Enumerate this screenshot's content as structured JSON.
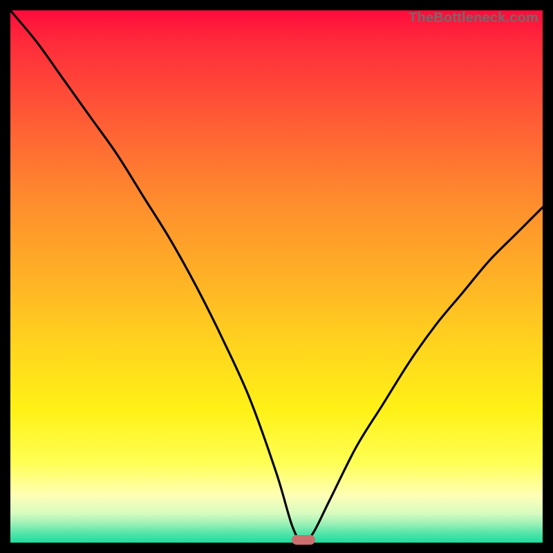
{
  "watermark": "TheBottleneck.com",
  "colors": {
    "frame": "#000000",
    "curve": "#000000",
    "marker": "#cc6f6f",
    "gradient_top": "#ff0b3b",
    "gradient_bottom": "#1ddc9f"
  },
  "chart_data": {
    "type": "line",
    "title": "",
    "xlabel": "",
    "ylabel": "",
    "xlim": [
      0,
      100
    ],
    "ylim": [
      0,
      100
    ],
    "x": [
      0,
      5,
      10,
      15,
      20,
      25,
      30,
      35,
      40,
      45,
      50,
      53,
      55,
      57,
      60,
      65,
      70,
      75,
      80,
      85,
      90,
      95,
      100
    ],
    "values": [
      100,
      94,
      87,
      80,
      73,
      65,
      57,
      48,
      38,
      27,
      13,
      3,
      0,
      2,
      8,
      18,
      26,
      34,
      41,
      47,
      53,
      58,
      63
    ],
    "marker_x": 55,
    "marker_y": 0,
    "annotations": []
  }
}
